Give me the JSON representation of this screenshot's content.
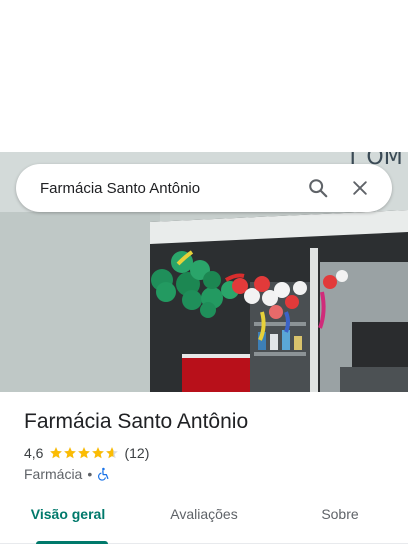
{
  "search": {
    "query": "Farmácia Santo Antônio"
  },
  "icons": {
    "search": "search-icon",
    "clear": "close-icon",
    "accessible": "wheelchair-icon"
  },
  "place": {
    "name": "Farmácia Santo Antônio",
    "rating": "4,6",
    "stars": 4.6,
    "review_count": "(12)",
    "category": "Farmácia",
    "separator": "•"
  },
  "tabs": [
    {
      "label": "Visão geral",
      "active": true
    },
    {
      "label": "Avaliações",
      "active": false
    },
    {
      "label": "Sobre",
      "active": false
    }
  ],
  "colors": {
    "accent": "#00796b",
    "star": "#fbbc04",
    "accessibility": "#1a73e8"
  }
}
